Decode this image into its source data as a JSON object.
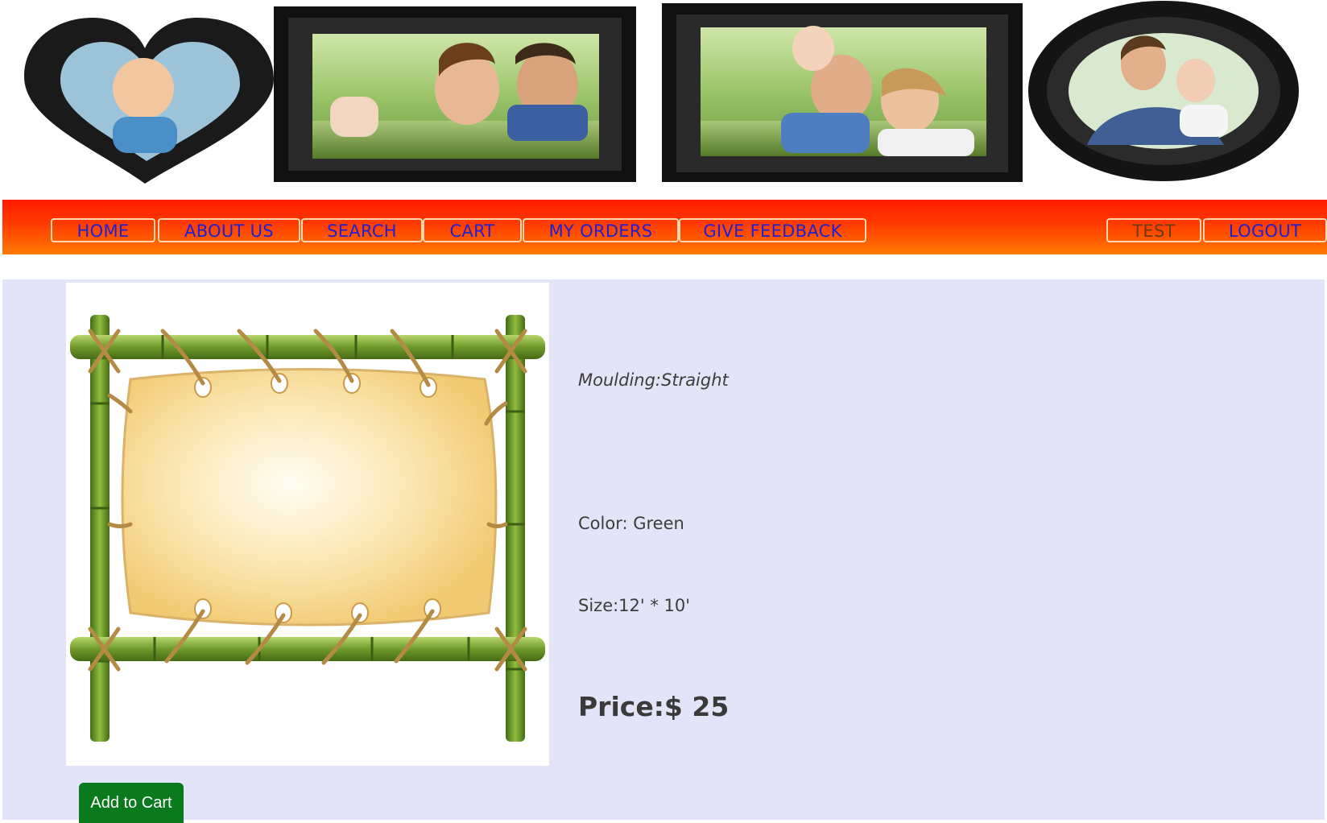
{
  "nav": {
    "items": [
      {
        "label": "HOME"
      },
      {
        "label": "ABOUT US"
      },
      {
        "label": "SEARCH"
      },
      {
        "label": "CART"
      },
      {
        "label": "MY ORDERS"
      },
      {
        "label": "GIVE FEEDBACK"
      }
    ],
    "right_items": [
      {
        "label": "TEST"
      },
      {
        "label": "LOGOUT"
      }
    ]
  },
  "product": {
    "moulding": "Moulding:Straight",
    "color": "Color: Green",
    "size": "Size:12' * 10'",
    "price": "Price:$ 25",
    "add_to_cart_label": "Add to Cart"
  },
  "colors": {
    "nav_gradient_top": "#ff1a00",
    "nav_gradient_bottom": "#ff7a00",
    "nav_text": "#1f1fd6",
    "content_bg": "#e4e4f8",
    "button_bg": "#0b7a1e"
  }
}
